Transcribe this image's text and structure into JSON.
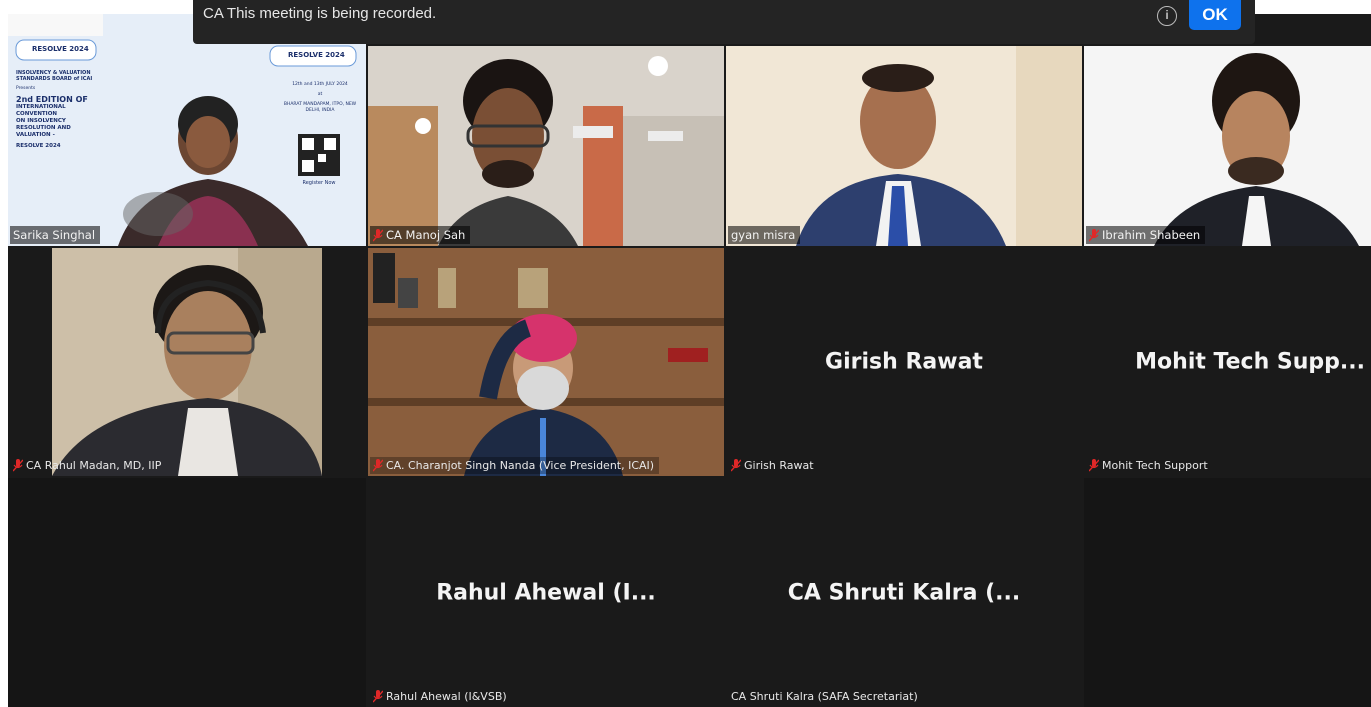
{
  "notification": {
    "text": "CA This meeting is being recorded.",
    "ok_label": "OK",
    "info_icon": "info-icon"
  },
  "tiles": [
    {
      "name": "Sarika Singhal",
      "type": "video",
      "muted": false,
      "active": true
    },
    {
      "name": "CA Manoj Sah",
      "type": "video",
      "muted": true
    },
    {
      "name": "gyan misra",
      "type": "video",
      "muted": false
    },
    {
      "name": "Ibrahim Shabeen",
      "type": "video",
      "muted": true
    },
    {
      "name": "CA Rahul Madan, MD, IIP",
      "type": "video",
      "muted": true
    },
    {
      "name": "CA. Charanjot Singh Nanda (Vice President, ICAI)",
      "type": "video",
      "muted": true
    },
    {
      "name": "Girish Rawat",
      "display_name": "Girish Rawat",
      "type": "avatar",
      "muted": true
    },
    {
      "name": "Mohit Tech Support",
      "display_name": "Mohit Tech Supp...",
      "type": "avatar",
      "muted": true
    },
    {
      "name": "",
      "type": "empty"
    },
    {
      "name": "Rahul Ahewal (I&VSB)",
      "display_name": "Rahul Ahewal (I...",
      "type": "avatar",
      "muted": true
    },
    {
      "name": "CA Shruti Kalra (SAFA Secretariat)",
      "display_name": "CA Shruti Kalra (...",
      "type": "avatar",
      "muted": false
    },
    {
      "name": "",
      "type": "empty"
    }
  ],
  "slide": {
    "logo1": "RESOLVE 2024",
    "logo2": "RESOLVE 2024",
    "org": "INSOLVENCY & VALUATION STANDARDS BOARD of ICAI",
    "presents": "Presents",
    "edition": "2nd EDITION OF",
    "lines": [
      "INTERNATIONAL",
      "CONVENTION",
      "ON INSOLVENCY",
      "RESOLUTION AND",
      "VALUATION -",
      "RESOLVE 2024"
    ],
    "date": "12th and 13th JULY 2024",
    "at": "at",
    "venue": "BHARAT MANDAPAM, ITPO, NEW DELHI, INDIA",
    "register": "Register Now"
  },
  "colors": {
    "active_border": "#36d17a",
    "ok_button": "#0e72ed",
    "muted_mic": "#e02828",
    "tile_bg": "#1a1a1a"
  }
}
